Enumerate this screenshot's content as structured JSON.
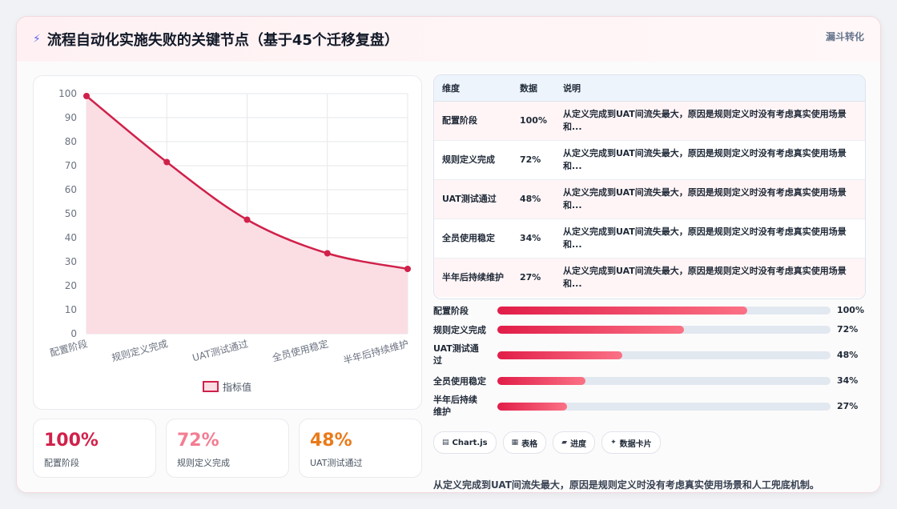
{
  "header": {
    "title": "流程自动化实施失败的关键节点（基于45个迁移复盘）",
    "icon": "zap-icon",
    "tag": "漏斗转化"
  },
  "chart_data": {
    "type": "area",
    "categories": [
      "配置阶段",
      "规则定义完成",
      "UAT测试通过",
      "全员使用稳定",
      "半年后持续维护"
    ],
    "series": [
      {
        "name": "指标值",
        "values": [
          99,
          71.5,
          47.5,
          33.5,
          27
        ]
      }
    ],
    "y_ticks": [
      "0",
      "10",
      "20",
      "30",
      "40",
      "50",
      "60",
      "70",
      "80",
      "90",
      "100"
    ],
    "ylim": [
      0,
      100
    ],
    "grid": true,
    "legend_position": "bottom",
    "colors": {
      "line": "#d0214a",
      "fill": "#fbdde4"
    }
  },
  "kpis": [
    {
      "value": "100%",
      "label": "配置阶段",
      "color": "#d0214a"
    },
    {
      "value": "72%",
      "label": "规则定义完成",
      "color": "#f37d92"
    },
    {
      "value": "48%",
      "label": "UAT测试通过",
      "color": "#ea7a1a"
    }
  ],
  "table": {
    "headers": [
      "维度",
      "数据",
      "说明"
    ],
    "rows": [
      [
        "配置阶段",
        "100%",
        "从定义完成到UAT间流失最大，原因是规则定义时没有考虑真实使用场景和..."
      ],
      [
        "规则定义完成",
        "72%",
        "从定义完成到UAT间流失最大，原因是规则定义时没有考虑真实使用场景和..."
      ],
      [
        "UAT测试通过",
        "48%",
        "从定义完成到UAT间流失最大，原因是规则定义时没有考虑真实使用场景和..."
      ],
      [
        "全员使用稳定",
        "34%",
        "从定义完成到UAT间流失最大，原因是规则定义时没有考虑真实使用场景和..."
      ],
      [
        "半年后持续维护",
        "27%",
        "从定义完成到UAT间流失最大，原因是规则定义时没有考虑真实使用场景和..."
      ]
    ]
  },
  "progress": [
    {
      "label": "配置阶段",
      "value": "100%",
      "fill": 0.75
    },
    {
      "label": "规则定义完成",
      "value": "72%",
      "fill": 0.56
    },
    {
      "label": "UAT测试通过",
      "value": "48%",
      "fill": 0.375
    },
    {
      "label": "全员使用稳定",
      "value": "34%",
      "fill": 0.265
    },
    {
      "label": "半年后持续维护",
      "value": "27%",
      "fill": 0.21
    }
  ],
  "chips": [
    {
      "icon": "chart-icon",
      "label": "Chart.js",
      "glyph": "▤"
    },
    {
      "icon": "table-icon",
      "label": "表格",
      "glyph": "▦"
    },
    {
      "icon": "progress-icon",
      "label": "进度",
      "glyph": "▰"
    },
    {
      "icon": "card-icon",
      "label": "数据卡片",
      "glyph": "✦"
    }
  ],
  "summary": "从定义完成到UAT间流失最大，原因是规则定义时没有考虑真实使用场景和人工兜底机制。"
}
